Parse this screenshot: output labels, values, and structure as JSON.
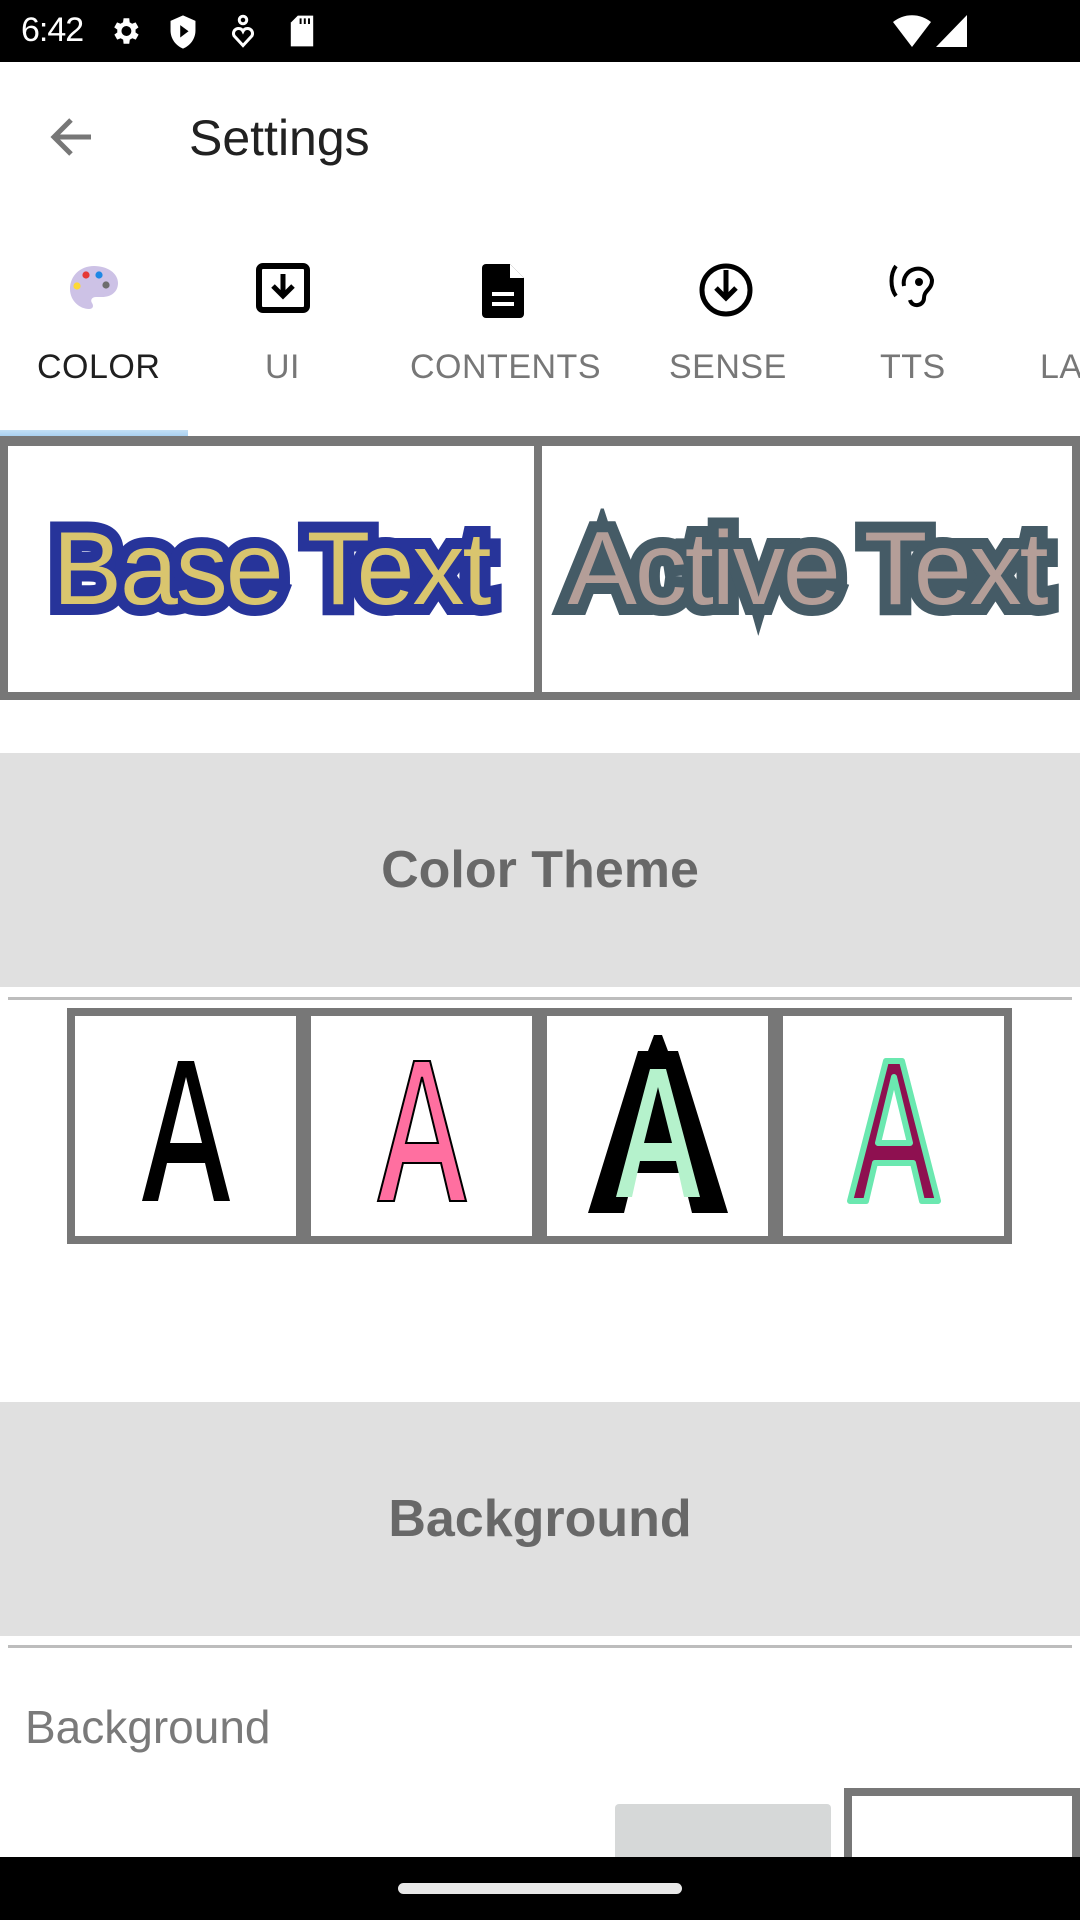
{
  "status_bar": {
    "time": "6:42",
    "left_icons": [
      "gear-icon",
      "shield-play-icon",
      "accessibility-heart-icon",
      "sd-card-icon"
    ],
    "right_icons": [
      "wifi-icon",
      "cellular-signal-icon"
    ]
  },
  "app_bar": {
    "back_icon": "arrow-back-icon",
    "title": "Settings"
  },
  "tabs": [
    {
      "label": "COLOR",
      "icon": "palette-icon",
      "active": true
    },
    {
      "label": "UI",
      "icon": "download-box-icon",
      "active": false
    },
    {
      "label": "CONTENTS",
      "icon": "document-icon",
      "active": false
    },
    {
      "label": "SENSE",
      "icon": "arrow-down-circle-icon",
      "active": false
    },
    {
      "label": "TTS",
      "icon": "hearing-icon",
      "active": false
    },
    {
      "label": "LA",
      "icon": "",
      "active": false
    }
  ],
  "preview": {
    "base_text": "Base Text",
    "active_text": "Active Text",
    "base_colors": {
      "fill": "#d9c56e",
      "outline": "#27349a"
    },
    "active_colors": {
      "fill": "#b49e98",
      "outline": "#455b66"
    }
  },
  "color_theme": {
    "title": "Color Theme",
    "options": [
      {
        "glyph": "A",
        "fill": "#000000",
        "outline": "none"
      },
      {
        "glyph": "A",
        "fill": "#ff6fa0",
        "outline": "#000000"
      },
      {
        "glyph": "A",
        "fill": "#b5f2cc",
        "outline": "#000000"
      },
      {
        "glyph": "A",
        "fill": "#8e1050",
        "outline": "#6be8b0"
      }
    ]
  },
  "background_section": {
    "title": "Background",
    "row_label": "Background"
  },
  "colors": {
    "tab_indicator": "#a9d0f0",
    "section_bg": "#e0e0e0",
    "border": "#777777"
  }
}
